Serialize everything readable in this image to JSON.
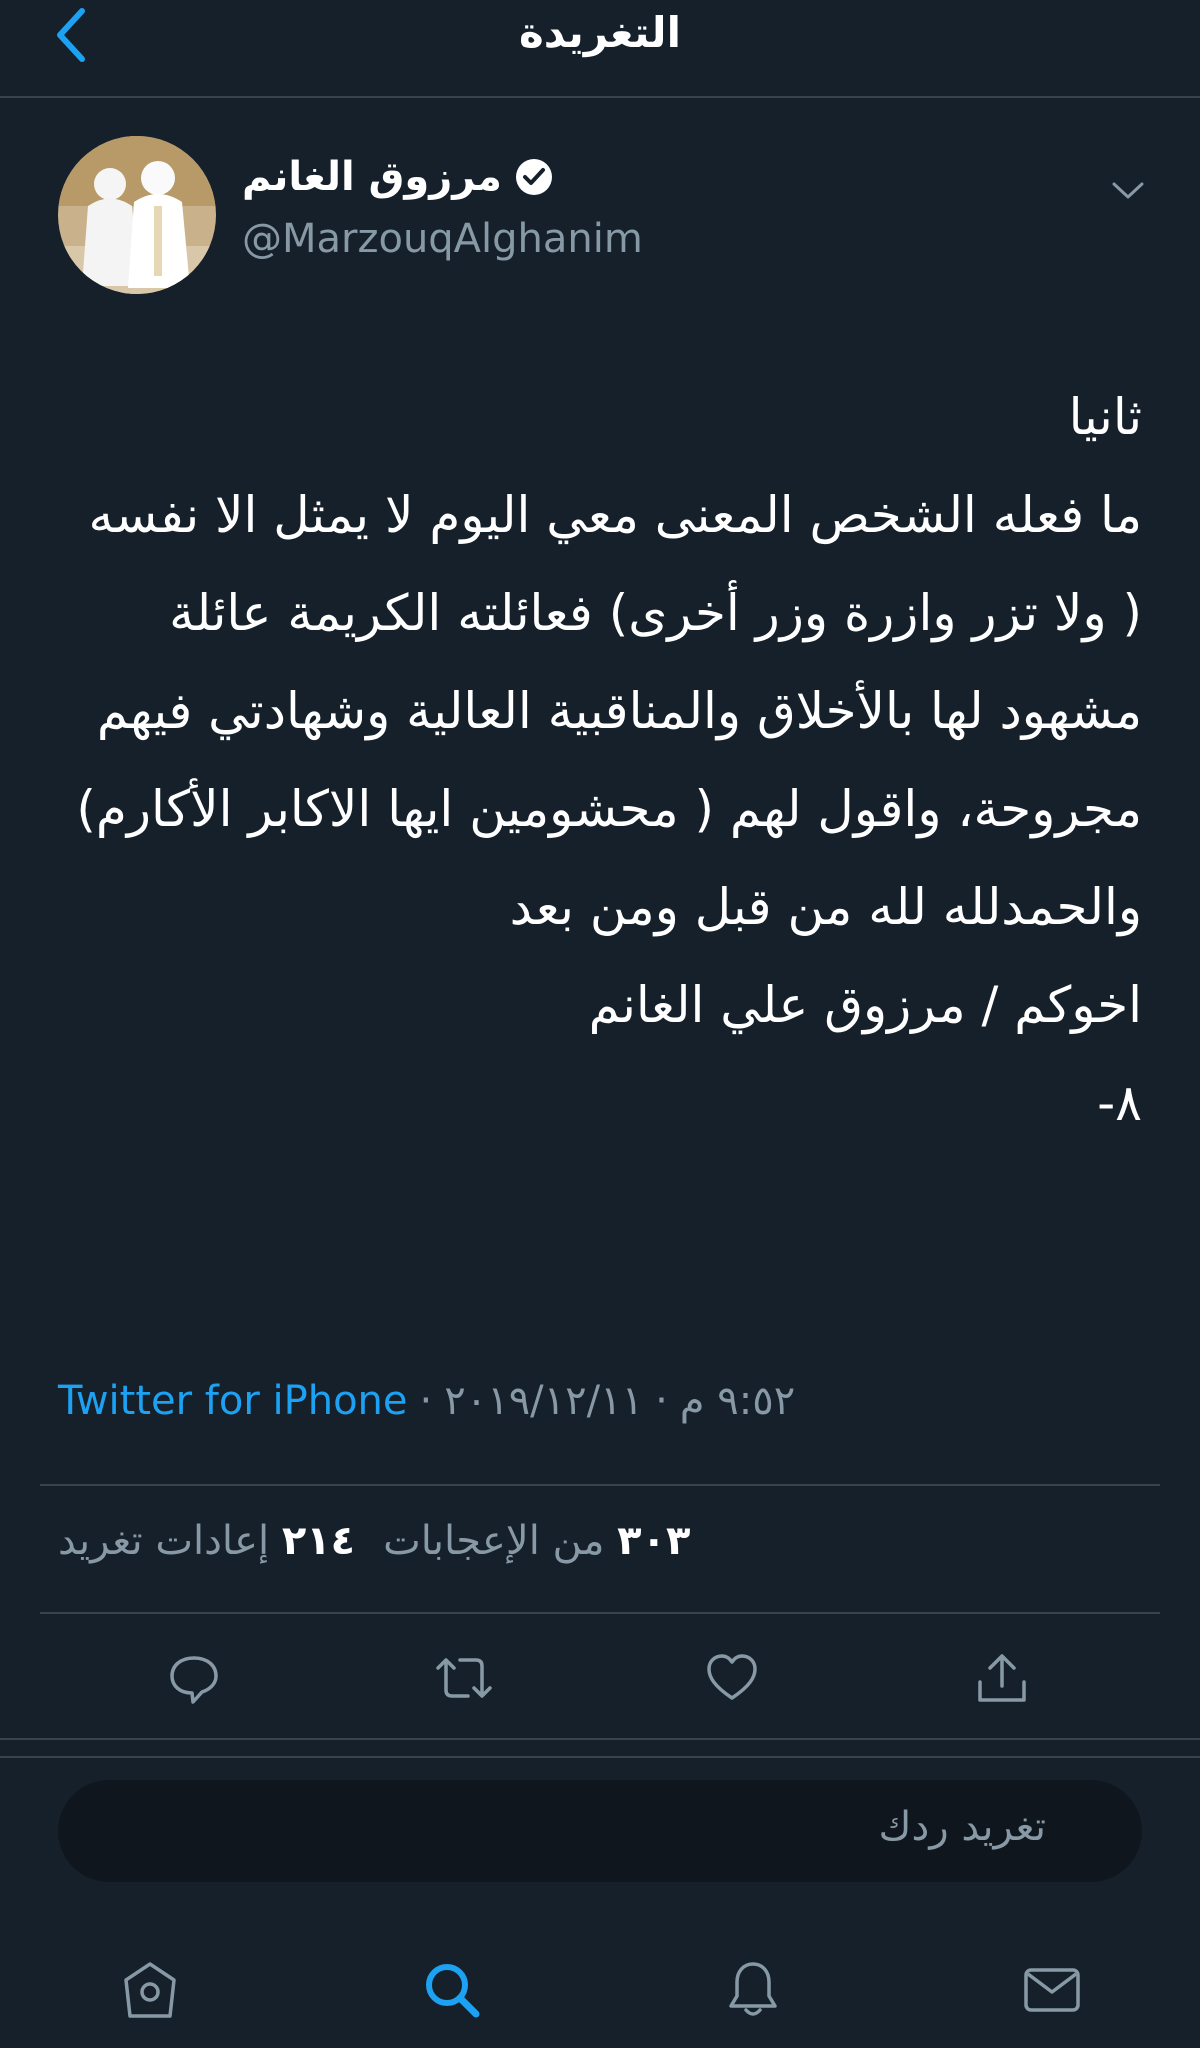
{
  "header": {
    "title": "التغريدة"
  },
  "tweet": {
    "author": {
      "name": "مرزوق الغانم",
      "handle": "@MarzouqAlghanim",
      "verified": true
    },
    "text": "ثانيا\nما فعله الشخص المعنى معي اليوم لا يمثل الا نفسه ( ولا تزر وازرة وزر أخرى) فعائلته الكريمة عائلة مشهود لها بالأخلاق والمناقبية العالية وشهادتي فيهم مجروحة، واقول لهم ( محشومين ايها الاكابر الأكارم)\nوالحمدلله لله من قبل ومن بعد\nاخوكم / مرزوق علي الغانم\n٨-",
    "time": "٩:٥٢ م",
    "date": "٢٠١٩/١٢/١١",
    "source": "Twitter for iPhone",
    "separator": "·",
    "stats": {
      "likes_count": "٣٠٣",
      "likes_label": "من الإعجابات",
      "retweets_count": "٢١٤",
      "retweets_label": "إعادات تغريد"
    }
  },
  "reply": {
    "placeholder": "تغريد ردك"
  },
  "colors": {
    "background": "#15202b",
    "accent": "#1da1f2",
    "muted": "#8899a6",
    "divider": "#38444d"
  },
  "icons": {
    "back": "chevron-left-icon",
    "verified": "verified-badge-icon",
    "more": "chevron-down-icon",
    "reply": "comment-icon",
    "retweet": "retweet-icon",
    "like": "heart-icon",
    "share": "share-icon",
    "home": "home-icon",
    "search": "search-icon",
    "notifications": "bell-icon",
    "messages": "mail-icon"
  }
}
